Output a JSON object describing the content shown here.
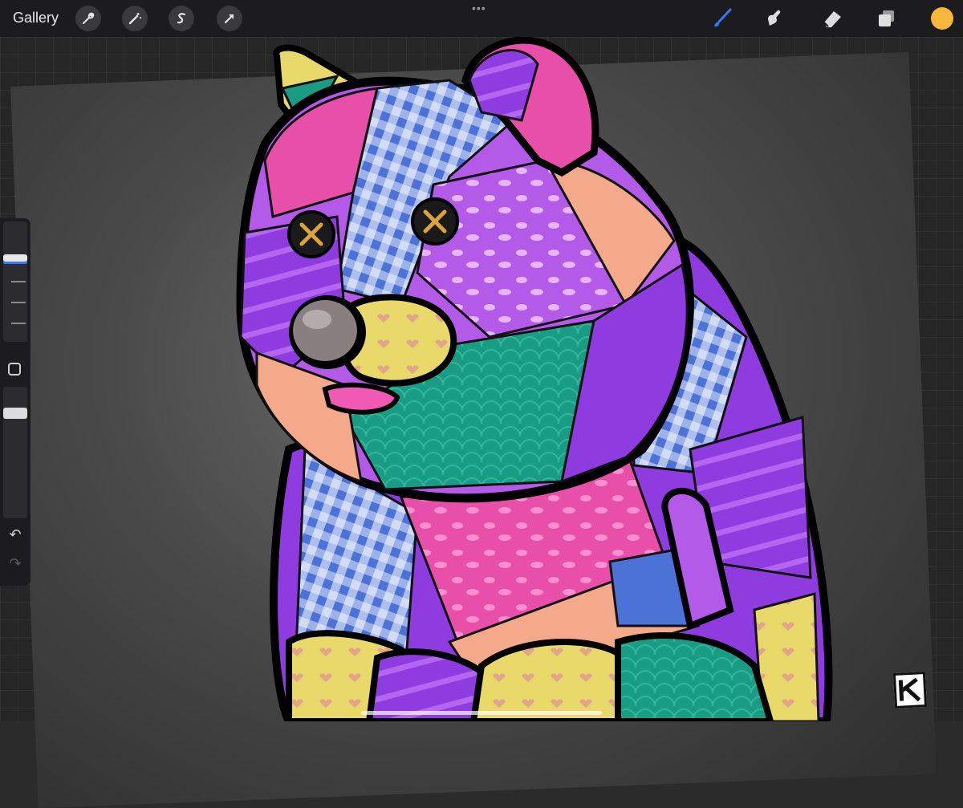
{
  "topbar": {
    "gallery_label": "Gallery",
    "more_icon": "ellipsis-icon",
    "left_tools": [
      "wrench-icon",
      "magic-wand-icon",
      "selection-icon",
      "transform-arrow-icon"
    ],
    "right_tools": [
      "brush-icon",
      "smudge-icon",
      "eraser-icon",
      "layers-icon"
    ],
    "active_tool": "brush",
    "current_color": "#F6B73C"
  },
  "sidebar": {
    "brush_size": 0.12,
    "opacity": 0.95,
    "undo_icon": "undo-icon",
    "redo_icon": "redo-icon"
  },
  "artwork": {
    "subject": "patchwork-teddy-bear",
    "signature_logo": "KC"
  },
  "colors": {
    "accent_blue": "#3478F6",
    "patch_purple": "#8E3CE0",
    "patch_teal": "#1A9B84",
    "patch_pink": "#E84FA8",
    "patch_yellow": "#E9D86A",
    "patch_peach": "#F4A98A",
    "patch_blue": "#4C72D8"
  }
}
